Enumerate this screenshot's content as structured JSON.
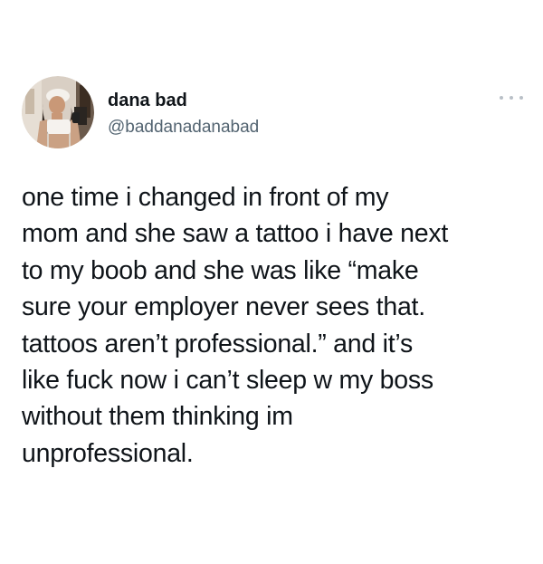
{
  "user": {
    "display_name": "dana bad",
    "handle": "@baddanadanabad",
    "avatar_icon": "profile-photo-avatar"
  },
  "more_icon": "more-horizontal-icon",
  "tweet": {
    "lines": [
      "one time i changed in front of my",
      "mom and she saw a tattoo i have next",
      "to my boob and she was like “make",
      "sure your employer never sees that.",
      "tattoos aren’t professional.” and it’s",
      "like fuck now i can’t sleep w my boss",
      "without them thinking im",
      "unprofessional."
    ]
  },
  "colors": {
    "background": "#ffffff",
    "text": "#0f1419",
    "secondary_text": "#536471",
    "more_dots": "#b9c0c7"
  }
}
